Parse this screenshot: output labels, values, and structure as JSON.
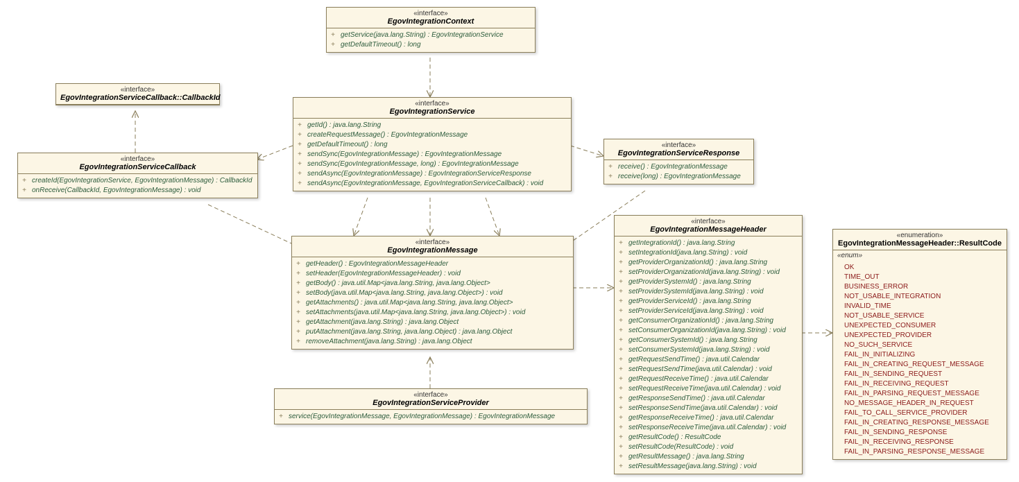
{
  "boxes": {
    "context": {
      "stereo": "«interface»",
      "name": "EgovIntegrationContext",
      "ops": [
        "getService(java.lang.String) : EgovIntegrationService",
        "getDefaultTimeout() : long"
      ]
    },
    "callbackId": {
      "stereo": "«interface»",
      "name": "EgovIntegrationServiceCallback::CallbackId",
      "ops": []
    },
    "callback": {
      "stereo": "«interface»",
      "name": "EgovIntegrationServiceCallback",
      "ops": [
        "createId(EgovIntegrationService, EgovIntegrationMessage) : CallbackId",
        "onReceive(CallbackId, EgovIntegrationMessage) : void"
      ]
    },
    "service": {
      "stereo": "«interface»",
      "name": "EgovIntegrationService",
      "ops": [
        "getId() : java.lang.String",
        "createRequestMessage() : EgovIntegrationMessage",
        "getDefaultTimeout() : long",
        "sendSync(EgovIntegrationMessage) : EgovIntegrationMessage",
        "sendSync(EgovIntegrationMessage, long) : EgovIntegrationMessage",
        "sendAsync(EgovIntegrationMessage) : EgovIntegrationServiceResponse",
        "sendAsync(EgovIntegrationMessage, EgovIntegrationServiceCallback) : void"
      ]
    },
    "response": {
      "stereo": "«interface»",
      "name": "EgovIntegrationServiceResponse",
      "ops": [
        "receive() : EgovIntegrationMessage",
        "receive(long) : EgovIntegrationMessage"
      ]
    },
    "message": {
      "stereo": "«interface»",
      "name": "EgovIntegrationMessage",
      "ops": [
        "getHeader() : EgovIntegrationMessageHeader",
        "setHeader(EgovIntegrationMessageHeader) : void",
        "getBody() : java.util.Map<java.lang.String, java.lang.Object>",
        "setBody(java.util.Map<java.lang.String, java.lang.Object>) : void",
        "getAttachments() : java.util.Map<java.lang.String, java.lang.Object>",
        "setAttachments(java.util.Map<java.lang.String, java.lang.Object>) : void",
        "getAttachment(java.lang.String) : java.lang.Object",
        "putAttachment(java.lang.String, java.lang.Object) : java.lang.Object",
        "removeAttachment(java.lang.String) : java.lang.Object"
      ]
    },
    "provider": {
      "stereo": "«interface»",
      "name": "EgovIntegrationServiceProvider",
      "ops": [
        "service(EgovIntegrationMessage, EgovIntegrationMessage) : EgovIntegrationMessage"
      ]
    },
    "header": {
      "stereo": "«interface»",
      "name": "EgovIntegrationMessageHeader",
      "ops": [
        "getIntegrationId() : java.lang.String",
        "setIntegrationId(java.lang.String) : void",
        "getProviderOrganizationId() : java.lang.String",
        "setProviderOrganizationId(java.lang.String) : void",
        "getProviderSystemId() : java.lang.String",
        "setProviderSystemId(java.lang.String) : void",
        "getProviderServiceId() : java.lang.String",
        "setProviderServiceId(java.lang.String) : void",
        "getConsumerOrganizationId() : java.lang.String",
        "setConsumerOrganizationId(java.lang.String) : void",
        "getConsumerSystemId() : java.lang.String",
        "setConsumerSystemId(java.lang.String) : void",
        "getRequestSendTime() : java.util.Calendar",
        "setRequestSendTime(java.util.Calendar) : void",
        "getRequestReceiveTime() : java.util.Calendar",
        "setRequestReceiveTime(java.util.Calendar) : void",
        "getResponseSendTime() : java.util.Calendar",
        "setResponseSendTime(java.util.Calendar) : void",
        "getResponseReceiveTime() : java.util.Calendar",
        "setResponseReceiveTime(java.util.Calendar) : void",
        "getResultCode() : ResultCode",
        "setResultCode(ResultCode) : void",
        "getResultMessage() : java.lang.String",
        "setResultMessage(java.lang.String) : void"
      ]
    },
    "resultCode": {
      "stereo": "«enumeration»",
      "name": "EgovIntegrationMessageHeader::ResultCode",
      "enumLabel": "«enum»",
      "values": [
        "OK",
        "TIME_OUT",
        "BUSINESS_ERROR",
        "NOT_USABLE_INTEGRATION",
        "INVALID_TIME",
        "NOT_USABLE_SERVICE",
        "UNEXPECTED_CONSUMER",
        "UNEXPECTED_PROVIDER",
        "NO_SUCH_SERVICE",
        "FAIL_IN_INITIALIZING",
        "FAIL_IN_CREATING_REQUEST_MESSAGE",
        "FAIL_IN_SENDING_REQUEST",
        "FAIL_IN_RECEIVING_REQUEST",
        "FAIL_IN_PARSING_REQUEST_MESSAGE",
        "NO_MESSAGE_HEADER_IN_REQUEST",
        "FAIL_TO_CALL_SERVICE_PROVIDER",
        "FAIL_IN_CREATING_RESPONSE_MESSAGE",
        "FAIL_IN_SENDING_RESPONSE",
        "FAIL_IN_RECEIVING_RESPONSE",
        "FAIL_IN_PARSING_RESPONSE_MESSAGE"
      ]
    }
  }
}
